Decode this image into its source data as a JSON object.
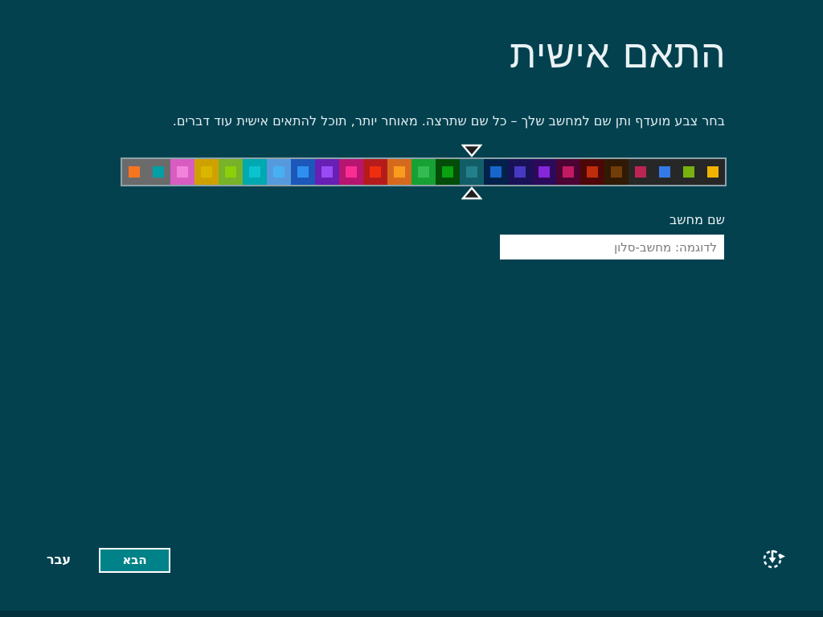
{
  "screen": {
    "background": "#03414f",
    "bottom_edge_color": "#02303c",
    "title": "התאם אישית",
    "subtitle": "בחר צבע מועדף ותן שם למחשב שלך – כל שם שתרצה. מאוחר יותר, תוכל להתאים אישית עוד דברים."
  },
  "color_picker": {
    "selected_index": 14,
    "arrow_fill": "#1f1f1f",
    "arrow_outline": "#ffffff",
    "strip_border": "#8ba3aa",
    "swatches": [
      {
        "bg": "#6b6b6b",
        "fg": "#f7751f"
      },
      {
        "bg": "#6b6b6b",
        "fg": "#00a0a6"
      },
      {
        "bg": "#d85cc2",
        "fg": "#f283dc"
      },
      {
        "bg": "#cfa100",
        "fg": "#d9b600"
      },
      {
        "bg": "#77b229",
        "fg": "#8bcf09"
      },
      {
        "bg": "#00a8b0",
        "fg": "#0bc3cf"
      },
      {
        "bg": "#569add",
        "fg": "#47b0f2"
      },
      {
        "bg": "#1c57ba",
        "fg": "#2d90f1"
      },
      {
        "bg": "#671fb4",
        "fg": "#9a4bf5"
      },
      {
        "bg": "#b81472",
        "fg": "#fa2e92"
      },
      {
        "bg": "#b61b1b",
        "fg": "#ef2e0e"
      },
      {
        "bg": "#d56a1e",
        "fg": "#f99b1c"
      },
      {
        "bg": "#17a033",
        "fg": "#35bb52"
      },
      {
        "bg": "#034d08",
        "fg": "#0aa00e"
      },
      {
        "bg": "#115e69",
        "fg": "#23808b"
      },
      {
        "bg": "#03224b",
        "fg": "#1766cc"
      },
      {
        "bg": "#191256",
        "fg": "#4739c2"
      },
      {
        "bg": "#2b0a5a",
        "fg": "#8526d8"
      },
      {
        "bg": "#4b0434",
        "fg": "#c31a62"
      },
      {
        "bg": "#4d0707",
        "fg": "#c02d0b"
      },
      {
        "bg": "#311a04",
        "fg": "#713d08"
      },
      {
        "bg": "#272727",
        "fg": "#bc2553"
      },
      {
        "bg": "#272727",
        "fg": "#337ae8"
      },
      {
        "bg": "#272727",
        "fg": "#77b20f"
      },
      {
        "bg": "#272727",
        "fg": "#f0b400"
      }
    ]
  },
  "pc_name": {
    "label": "שם מחשב",
    "placeholder": "לדוגמה: מחשב-סלון",
    "value": ""
  },
  "footer": {
    "language_indicator": "עבר",
    "next_button_label": "הבא",
    "next_button_color": "#008288",
    "ease_of_access_icon": "ease-of-access-icon"
  }
}
